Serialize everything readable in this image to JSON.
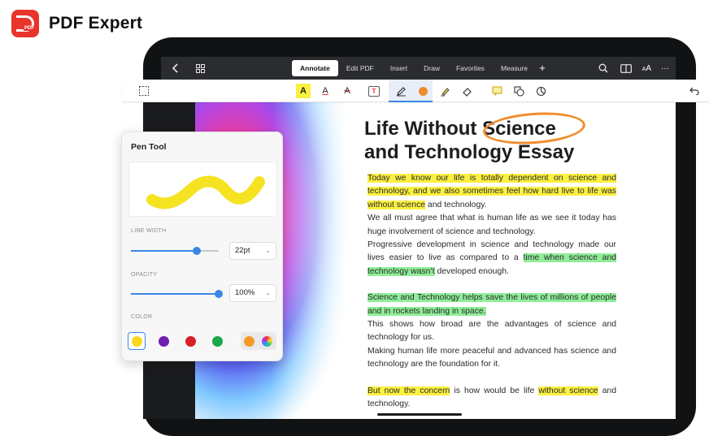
{
  "brand": {
    "logo_text": "PDF",
    "name": "PDF Expert"
  },
  "topbar": {
    "back_icon": "chevron-left-icon",
    "grid_icon": "grid-icon",
    "tabs": [
      {
        "label": "Annotate",
        "active": true
      },
      {
        "label": "Edit PDF"
      },
      {
        "label": "Insert"
      },
      {
        "label": "Draw"
      },
      {
        "label": "Favorites"
      },
      {
        "label": "Measure"
      }
    ],
    "add_tab": "+",
    "right_icons": [
      "search-icon",
      "book-icon",
      "text-size-icon",
      "more-icon"
    ],
    "text_size_label_small": "A",
    "text_size_label_large": "A",
    "more_label": "···"
  },
  "toolrow": {
    "highlight_tool": "A",
    "underline_tool": "A",
    "strike_tool": "A",
    "textbox_tool": "T",
    "undo_icon": "undo-icon",
    "active_color": "#f08c2b"
  },
  "document": {
    "title_line1": "Life Without Science",
    "title_line2": "and Technology Essay",
    "p1_hl1": "Today we know our life is totally dependent on science and technology, and we also sometimes feel how hard live to life was without science",
    "p1_t1": " and technology.",
    "p1_t2": "We all must agree that what is human life as we see it today has huge involvement of science and technology.",
    "p1_t3": "Progressive development in science and technology made our lives easier to live as compared to a ",
    "p1_hl2": "time when science and technology wasn’t",
    "p1_t4": " developed enough.",
    "p2_hl1": "Science and Technology helps save the lives of millions of people and in rockets landing in space.",
    "p2_t1": "This shows how broad are the advantages of science and technology for us.",
    "p2_t2": "Making human life more peaceful and advanced has science and technology are the foundation for it.",
    "p3_hl1": "But now the concern",
    "p3_t1": " is how would be life ",
    "p3_hl2": "without science",
    "p3_t2": " and technology."
  },
  "pen_tool": {
    "title": "Pen Tool",
    "preview_color": "#f5e322",
    "line_width_label": "LINE WIDTH",
    "line_width_value": "22pt",
    "line_width_fraction": 0.75,
    "opacity_label": "OPACITY",
    "opacity_value": "100%",
    "opacity_fraction": 1.0,
    "color_label": "COLOR",
    "colors": [
      "#f8d81e",
      "#6f1fb0",
      "#d81f26",
      "#1aa84a"
    ],
    "selected_color": "#f8d81e",
    "recent_color": "#f39a25"
  }
}
